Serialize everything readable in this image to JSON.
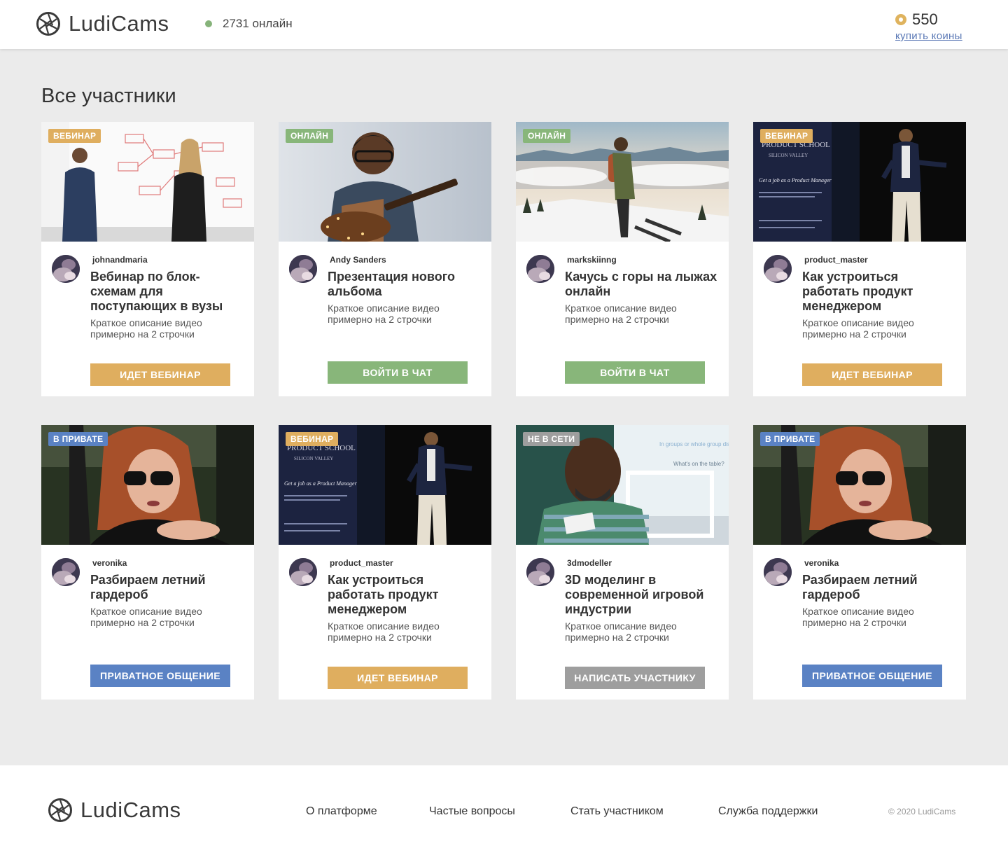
{
  "header": {
    "logo_text": "LudiCams",
    "online_text": "2731 онлайн",
    "coins": "550",
    "buy_coins": "купить коины"
  },
  "page_title": "Все участники",
  "colors": {
    "webinar": "#dfae5f",
    "online": "#88b67a",
    "private": "#5a82c4",
    "offline": "#9e9e9e"
  },
  "cards": [
    {
      "badge": "ВЕБИНАР",
      "author": "johnandmaria",
      "title": "Вебинар по блок-схемам для поступающих в вузы",
      "desc": "Краткое описание видео примерно на 2 строчки",
      "button": "ИДЕТ ВЕБИНАР",
      "image": "whiteboard-meeting"
    },
    {
      "badge": "ОНЛАЙН",
      "author": "Andy Sanders",
      "title": "Презентация нового альбома",
      "desc": "Краткое описание видео примерно на 2 строчки",
      "button": "ВОЙТИ В ЧАТ",
      "image": "guitar-player"
    },
    {
      "badge": "ОНЛАЙН",
      "author": "markskiinng",
      "title": "Качусь с горы на лыжах онлайн",
      "desc": "Краткое описание видео примерно на 2 строчки",
      "button": "ВОЙТИ В ЧАТ",
      "image": "skier-mountain"
    },
    {
      "badge": "ВЕБИНАР",
      "author": "product_master",
      "title": "Как устроиться работать продукт менеджером",
      "desc": "Краткое описание видео примерно на 2 строчки",
      "button": "ИДЕТ ВЕБИНАР",
      "image": "product-school-speaker",
      "banner": {
        "line1": "PRODUCT SCHOOL",
        "line2": "SILICON VALLEY",
        "line3": "Get a job as a Product Manager"
      }
    },
    {
      "badge": "В ПРИВАТЕ",
      "author": "veronika",
      "title": "Разбираем летний гардероб",
      "desc": "Краткое описание видео примерно на 2 строчки",
      "button": "ПРИВАТНОЕ ОБЩЕНИЕ",
      "image": "woman-in-car"
    },
    {
      "badge": "ВЕБИНАР",
      "author": "product_master",
      "title": "Как устроиться работать продукт менеджером",
      "desc": "Краткое описание видео примерно на 2 строчки",
      "button": "ИДЕТ ВЕБИНАР",
      "image": "product-school-speaker",
      "banner": {
        "line1": "PRODUCT SCHOOL",
        "line2": "SILICON VALLEY",
        "line3": "Get a job as a Product Manager"
      }
    },
    {
      "badge": "НЕ В СЕТИ",
      "author": "3dmodeller",
      "title": "3D моделинг в современной игровой индустрии",
      "desc": "Краткое описание видео примерно на 2 строчки",
      "button": "НАПИСАТЬ УЧАСТНИКУ",
      "image": "smiling-man-presentation"
    },
    {
      "badge": "В ПРИВАТЕ",
      "author": "veronika",
      "title": "Разбираем летний гардероб",
      "desc": "Краткое описание видео примерно на 2 строчки",
      "button": "ПРИВАТНОЕ ОБЩЕНИЕ",
      "image": "woman-in-car"
    }
  ],
  "footer": {
    "logo_text": "LudiCams",
    "links": [
      "О платформе",
      "Частые вопросы",
      "Стать участником",
      "Служба поддержки"
    ],
    "copyright": "© 2020 LudiCams"
  }
}
